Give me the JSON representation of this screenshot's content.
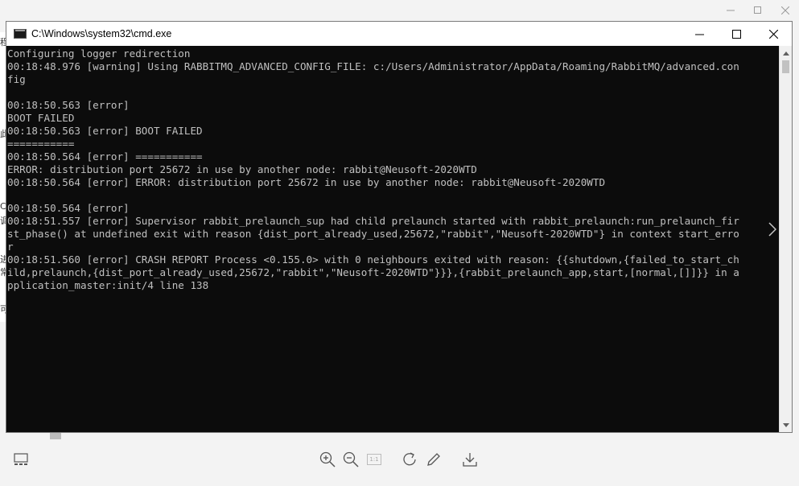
{
  "window": {
    "title": "C:\\Windows\\system32\\cmd.exe"
  },
  "console": {
    "lines": [
      "Configuring logger redirection",
      "00:18:48.976 [warning] Using RABBITMQ_ADVANCED_CONFIG_FILE: c:/Users/Administrator/AppData/Roaming/RabbitMQ/advanced.con",
      "fig",
      "",
      "00:18:50.563 [error]",
      "BOOT FAILED",
      "00:18:50.563 [error] BOOT FAILED",
      "===========",
      "00:18:50.564 [error] ===========",
      "ERROR: distribution port 25672 in use by another node: rabbit@Neusoft-2020WTD",
      "00:18:50.564 [error] ERROR: distribution port 25672 in use by another node: rabbit@Neusoft-2020WTD",
      "",
      "00:18:50.564 [error]",
      "00:18:51.557 [error] Supervisor rabbit_prelaunch_sup had child prelaunch started with rabbit_prelaunch:run_prelaunch_fir",
      "st_phase() at undefined exit with reason {dist_port_already_used,25672,\"rabbit\",\"Neusoft-2020WTD\"} in context start_erro",
      "r",
      "00:18:51.560 [error] CRASH REPORT Process <0.155.0> with 0 neighbours exited with reason: {{shutdown,{failed_to_start_ch",
      "ild,prelaunch,{dist_port_already_used,25672,\"rabbit\",\"Neusoft-2020WTD\"}}},{rabbit_prelaunch_app,start,[normal,[]]}} in a",
      "pplication_master:init/4 line 138"
    ]
  },
  "left_strip": {
    "glyphs": [
      "程",
      "此",
      "C",
      "调",
      "进",
      "常",
      "可"
    ]
  },
  "toolbar": {
    "fit_label": "1:1"
  },
  "icons": {
    "outer_minimize": "minimize-icon",
    "outer_maximize": "maximize-icon",
    "outer_close": "close-icon",
    "thumbnail": "thumbnail-icon",
    "zoom_in": "zoom-in-icon",
    "zoom_out": "zoom-out-icon",
    "actual_size": "actual-size-icon",
    "rotate": "rotate-icon",
    "edit": "pencil-icon",
    "download": "download-icon"
  }
}
